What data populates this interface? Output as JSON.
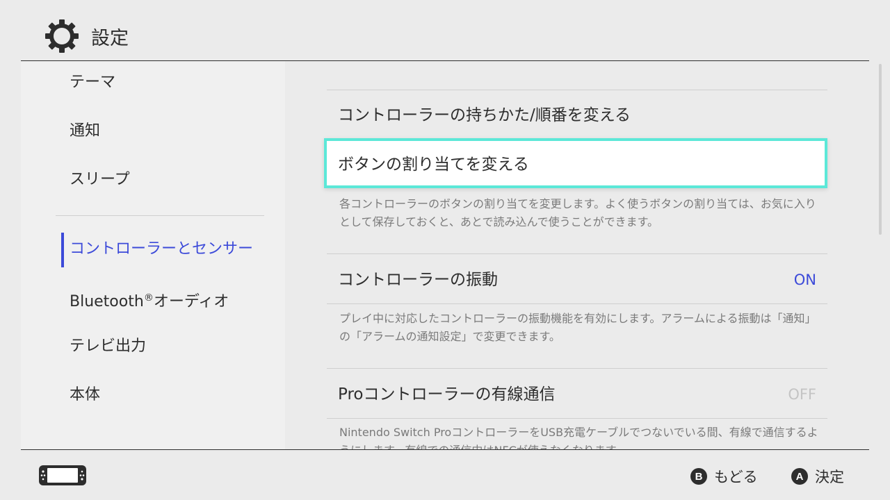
{
  "header": {
    "title": "設定",
    "icon": "gear-icon"
  },
  "sidebar": {
    "items": [
      {
        "label": "テーマ"
      },
      {
        "label": "通知"
      },
      {
        "label": "スリープ"
      },
      {
        "label": "コントローラーとセンサー",
        "active": true
      },
      {
        "label": "Bluetooth",
        "suffix_mark": "®",
        "suffix": "オーディオ"
      },
      {
        "label": "テレビ出力"
      },
      {
        "label": "本体"
      }
    ]
  },
  "content": {
    "rows": [
      {
        "label": "コントローラーの持ちかた/順番を変える"
      },
      {
        "label": "ボタンの割り当てを変える",
        "selected": true,
        "description": "各コントローラーのボタンの割り当てを変更します。よく使うボタンの割り当ては、お気に入りとして保存しておくと、あとで読み込んで使うことができます。"
      },
      {
        "label": "コントローラーの振動",
        "value": "ON",
        "description": "プレイ中に対応したコントローラーの振動機能を有効にします。アラームによる振動は「通知」の「アラームの通知設定」で変更できます。"
      },
      {
        "label": "Proコントローラーの有線通信",
        "value": "OFF",
        "description": "Nintendo Switch ProコントローラーをUSB充電ケーブルでつないでいる間、有線で通信するようにします。有線での通信中はNFCが使えなくなります。"
      }
    ]
  },
  "footer": {
    "console_icon": "console-icon",
    "back": {
      "glyph": "B",
      "label": "もどる"
    },
    "confirm": {
      "glyph": "A",
      "label": "決定"
    }
  },
  "colors": {
    "accent": "#3c4ad9",
    "highlight": "#5ce8d8",
    "background": "#ebebeb"
  }
}
